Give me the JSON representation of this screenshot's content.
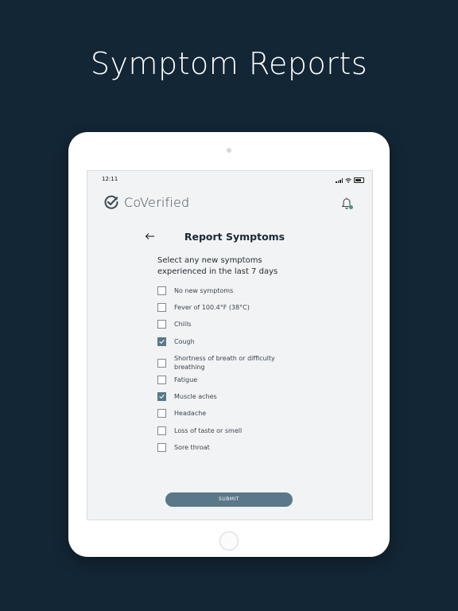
{
  "headline": "Symptom Reports",
  "status_bar": {
    "time": "12:11"
  },
  "app": {
    "name": "CoVerified"
  },
  "screen": {
    "title": "Report Symptoms",
    "prompt": "Select any new symptoms experienced in the last 7 days",
    "symptoms": [
      {
        "label": "No new symptoms",
        "checked": false
      },
      {
        "label": "Fever of 100.4°F (38°C)",
        "checked": false
      },
      {
        "label": "Chills",
        "checked": false
      },
      {
        "label": "Cough",
        "checked": true
      },
      {
        "label": "Shortness of breath or difficulty breathing",
        "checked": false
      },
      {
        "label": "Fatigue",
        "checked": false
      },
      {
        "label": "Muscle aches",
        "checked": true
      },
      {
        "label": "Headache",
        "checked": false
      },
      {
        "label": "Loss of taste or smell",
        "checked": false
      },
      {
        "label": "Sore throat",
        "checked": false
      }
    ],
    "submit_label": "SUBMIT"
  },
  "icons": {
    "logo": "check-circle-icon",
    "back": "arrow-left-icon",
    "notifications": "bell-icon"
  },
  "colors": {
    "background": "#132635",
    "accent": "#5a7888",
    "notification_dot": "#4a9a7a"
  }
}
